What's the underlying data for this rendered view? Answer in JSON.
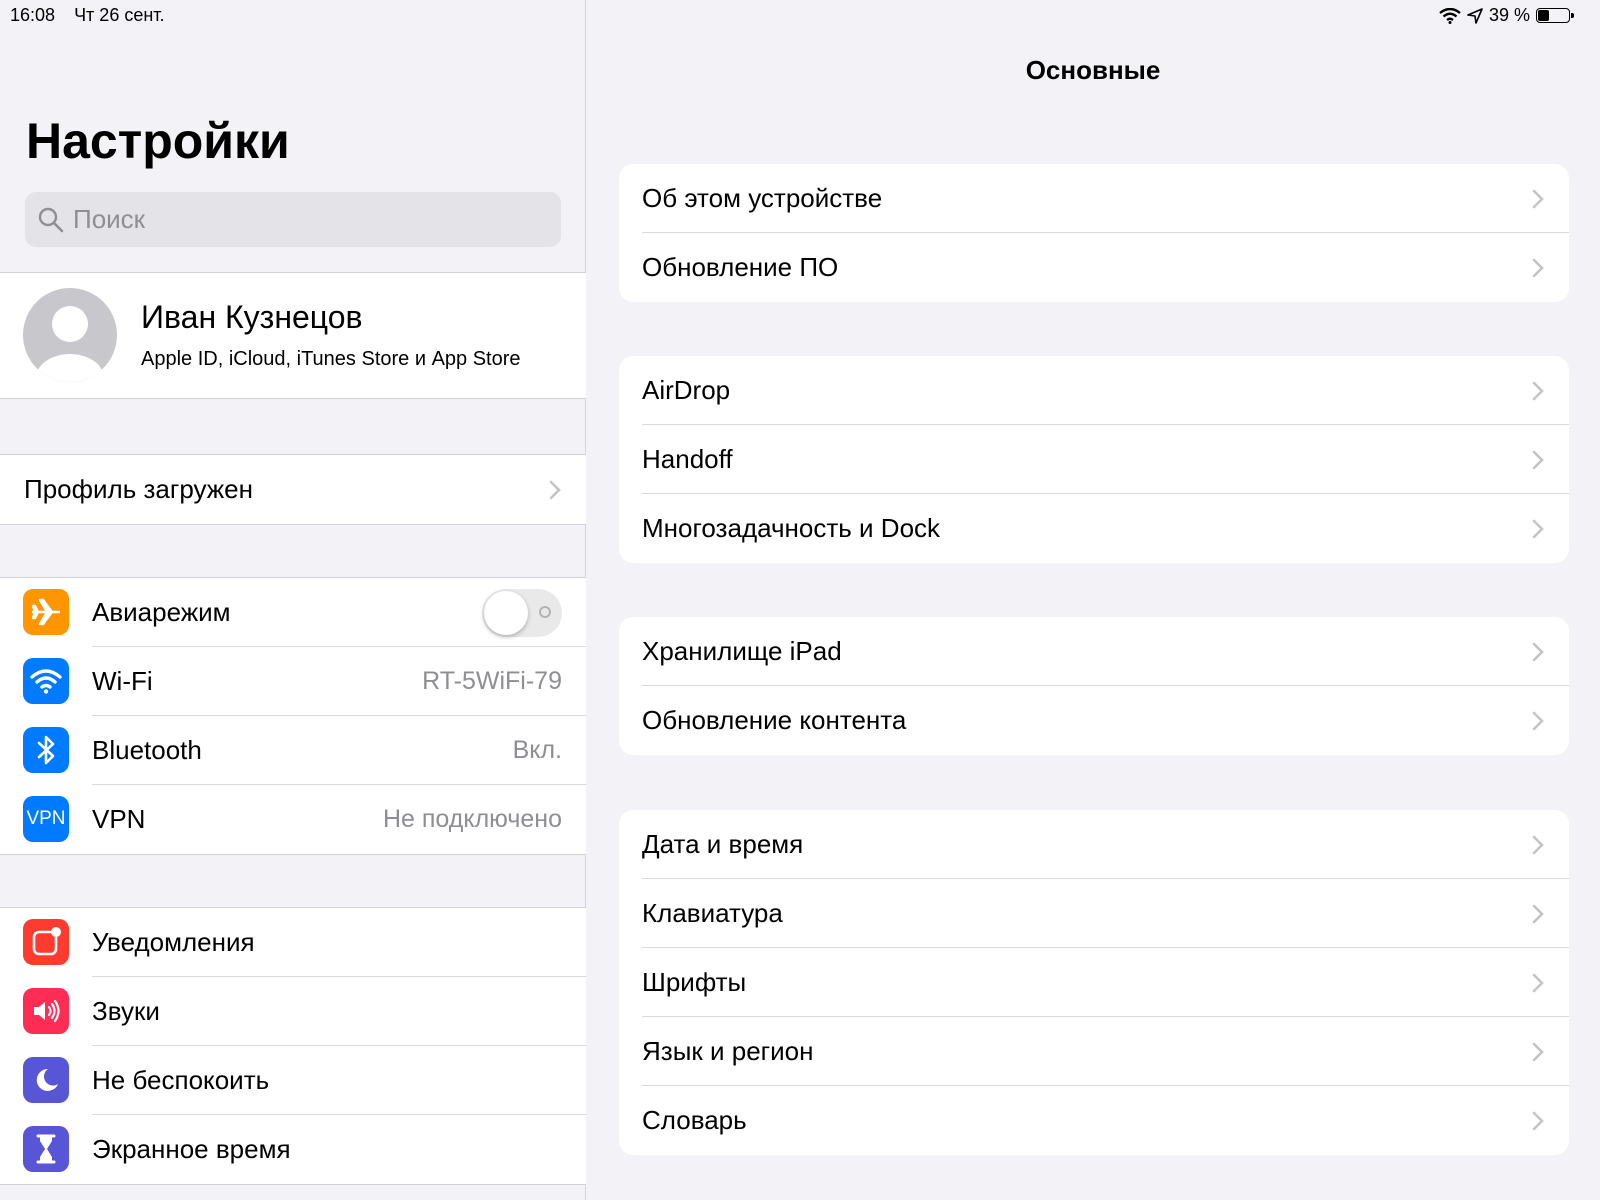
{
  "status": {
    "time": "16:08",
    "date": "Чт 26 сент.",
    "battery_text": "39 %",
    "battery_level": 0.39
  },
  "sidebar": {
    "title": "Настройки",
    "search_placeholder": "Поиск",
    "profile": {
      "name": "Иван Кузнецов",
      "subtitle": "Apple ID, iCloud, iTunes Store и App Store"
    },
    "profile_loaded": "Профиль загружен",
    "connectivity": [
      {
        "label": "Авиарежим",
        "icon": "airplane-icon",
        "color": "#ff9500",
        "toggle": false
      },
      {
        "label": "Wi-Fi",
        "icon": "wifi-icon",
        "color": "#007aff",
        "value": "RT-5WiFi-79"
      },
      {
        "label": "Bluetooth",
        "icon": "bluetooth-icon",
        "color": "#007aff",
        "value": "Вкл."
      },
      {
        "label": "VPN",
        "icon": "vpn-icon",
        "icon_text": "VPN",
        "color": "#007aff",
        "value": "Не подключено"
      }
    ],
    "general": [
      {
        "label": "Уведомления",
        "icon": "notifications-icon",
        "color": "#ff3b30"
      },
      {
        "label": "Звуки",
        "icon": "sounds-icon",
        "color": "#ff2d55"
      },
      {
        "label": "Не беспокоить",
        "icon": "moon-icon",
        "color": "#5856d6"
      },
      {
        "label": "Экранное время",
        "icon": "hourglass-icon",
        "color": "#5856d6"
      }
    ]
  },
  "detail": {
    "title": "Основные",
    "groups": [
      [
        "Об этом устройстве",
        "Обновление ПО"
      ],
      [
        "AirDrop",
        "Handoff",
        "Многозадачность и Dock"
      ],
      [
        "Хранилище iPad",
        "Обновление контента"
      ],
      [
        "Дата и время",
        "Клавиатура",
        "Шрифты",
        "Язык и регион",
        "Словарь"
      ]
    ]
  }
}
